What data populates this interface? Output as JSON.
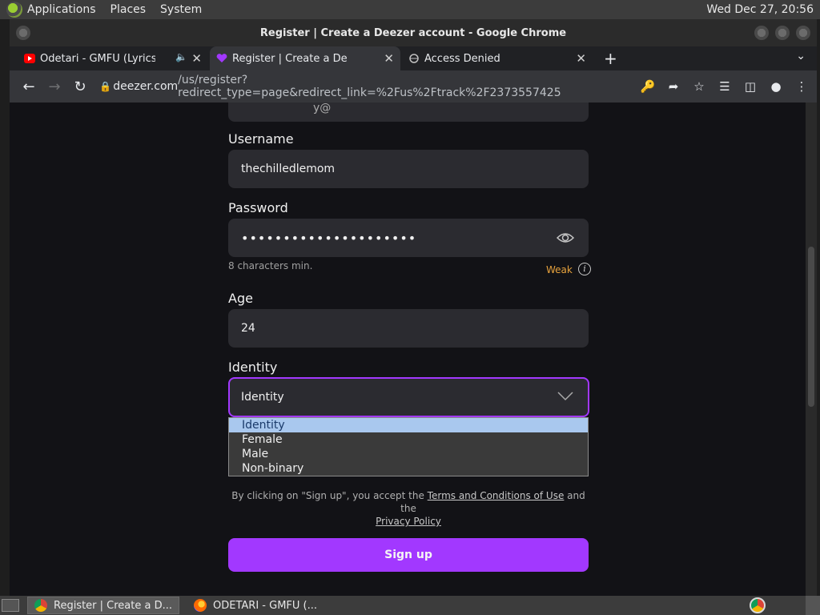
{
  "top_panel": {
    "menus": [
      "Applications",
      "Places",
      "System"
    ],
    "clock": "Wed Dec 27, 20:56"
  },
  "window": {
    "title": "Register | Create a Deezer account - Google Chrome"
  },
  "tabs": [
    {
      "title": "Odetari - GMFU (Lyrics) ft",
      "favicon": "youtube-icon",
      "audio": true
    },
    {
      "title": "Register | Create a Deezer acc",
      "favicon": "deezer-heart-icon",
      "active": true
    },
    {
      "title": "Access Denied",
      "favicon": "globe-icon"
    }
  ],
  "omnibox": {
    "host": "deezer.com",
    "path": "/us/register?redirect_type=page&redirect_link=%2Fus%2Ftrack%2F2373557425"
  },
  "form": {
    "email_partial": "y@",
    "username_label": "Username",
    "username_value": "thechilledlemom",
    "password_label": "Password",
    "password_mask": "•••••••••••••••••••••",
    "password_hint": "8 characters min.",
    "strength": "Weak",
    "age_label": "Age",
    "age_value": "24",
    "identity_label": "Identity",
    "identity_value": "Identity",
    "identity_options": [
      "Identity",
      "Female",
      "Male",
      "Non-binary"
    ],
    "terms_prefix": "By clicking on \"Sign up\", you accept the",
    "terms_link": "Terms and Conditions of Use",
    "terms_and": "and the",
    "privacy_link": "Privacy Policy",
    "signup_label": "Sign up"
  },
  "taskbar": {
    "tasks": [
      {
        "label": "Register | Create a D...",
        "icon": "chrome-icon",
        "active": true
      },
      {
        "label": "ODETARI - GMFU (...",
        "icon": "firefox-icon"
      }
    ]
  },
  "colors": {
    "accent": "#a238ff",
    "weak": "#e8a33d",
    "page_bg": "#121216"
  }
}
